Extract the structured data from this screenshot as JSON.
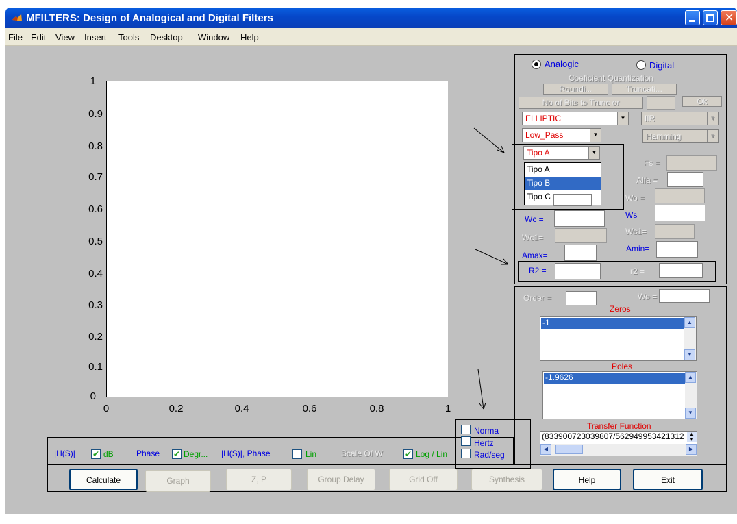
{
  "window": {
    "title": "MFILTERS:  Design of Analogical and Digital Filters"
  },
  "menubar": {
    "items": [
      "File",
      "Edit",
      "View",
      "Insert",
      "Tools",
      "Desktop",
      "Window",
      "Help"
    ]
  },
  "plot": {
    "y_ticks": [
      "0",
      "0.1",
      "0.2",
      "0.3",
      "0.4",
      "0.5",
      "0.6",
      "0.7",
      "0.8",
      "0.9",
      "1"
    ],
    "x_ticks": [
      "0",
      "0.2",
      "0.4",
      "0.6",
      "0.8",
      "1"
    ]
  },
  "mode": {
    "analogic_label": "Analogic",
    "digital_label": "Digital",
    "selected": "Analogic"
  },
  "quantization": {
    "title": "Coeficient Quantization",
    "round_label": "Roundi...",
    "trunc_label": "Truncati...",
    "bits_label": "No of Bits to Trunc or",
    "ok_label": "Ok"
  },
  "filter": {
    "approx": "ELLIPTIC",
    "band": "Low_Pass",
    "type": "Tipo A",
    "type_options": [
      "Tipo A",
      "Tipo B",
      "Tipo C"
    ],
    "type_highlighted": "Tipo B",
    "digital_kind": "IIR",
    "window": "Hamming"
  },
  "params": {
    "fs": "Fs =",
    "alfa": "Alfa =",
    "wo": "Wo =",
    "ws": "Ws =",
    "ws1": "Ws1=",
    "wc": "Wc =",
    "wc1": "Wc1=",
    "amin": "Amin=",
    "amax": "Amax=",
    "R2": "R2 =",
    "r2": "r2 ="
  },
  "results": {
    "order_label": "Order =",
    "wo_label": "Wo =",
    "zeros_title": "Zeros",
    "zeros": [
      "-1"
    ],
    "poles_title": "Poles",
    "poles": [
      "-1.9626"
    ],
    "tf_title": "Transfer Function",
    "tf_value": "(833900723039807/562949953421312"
  },
  "options": {
    "mag_label": "|H(S)|",
    "db_label": "dB",
    "phase_label": "Phase",
    "degr_label": "Degr...",
    "hs_phase_label": "|H(S)|, Phase",
    "lin_label": "Lin",
    "scale_label": "Scale Of W",
    "loglin_label": "Log / Lin",
    "norma_label": "Norma",
    "hertz_label": "Hertz",
    "radseg_label": "Rad/seg"
  },
  "buttons": {
    "calculate": "Calculate",
    "graph": "Graph",
    "zp": "Z, P",
    "group_delay": "Group Delay",
    "grid_off": "Grid Off",
    "synthesis": "Synthesis",
    "help": "Help",
    "exit": "Exit"
  },
  "colors": {
    "titlebar": "#0a5fe0",
    "figure_bg": "#c0c0c0",
    "label_blue": "#0000e0",
    "label_red": "#e00000",
    "check_green": "#00a000"
  }
}
